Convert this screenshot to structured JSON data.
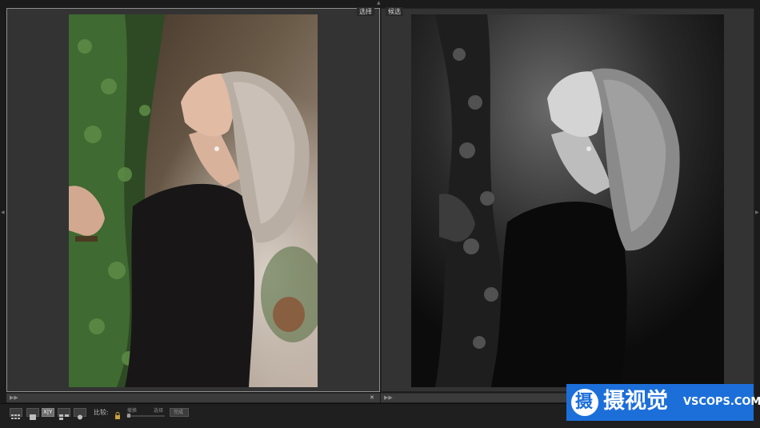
{
  "left_pane": {
    "tag": "选择"
  },
  "right_pane": {
    "tag": "候选"
  },
  "toolbar": {
    "compare_label": "比较:",
    "xy_label": "X|Y",
    "swap_label": "撤换",
    "select_label": "选择",
    "done_label": "完成"
  },
  "icons": [
    "grid-view-icon",
    "loupe-view-icon",
    "compare-view-icon",
    "survey-view-icon",
    "people-view-icon",
    "lock-icon",
    "close-icon",
    "filmstrip-arrow-icon"
  ],
  "watermark": {
    "brand": "摄视觉",
    "site": "VSCOPS.COM",
    "logo_char": "摄"
  },
  "colors": {
    "accent": "#1c6fd9",
    "pane_bg": "#333333",
    "selected_border": "#8e8e8e"
  }
}
